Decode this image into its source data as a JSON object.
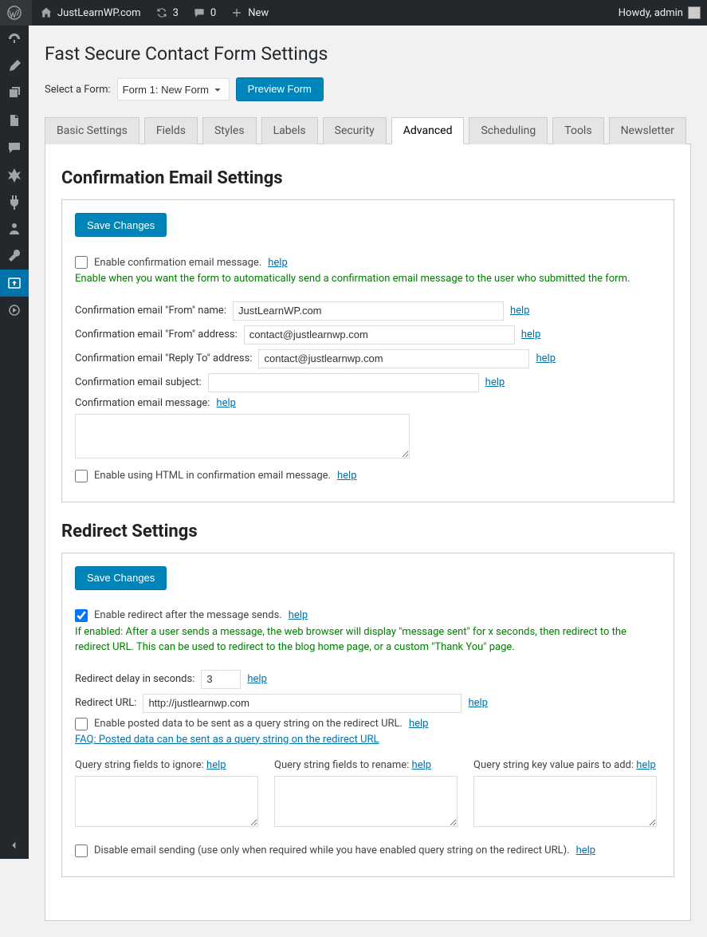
{
  "adminbar": {
    "site_name": "JustLearnWP.com",
    "updates_count": "3",
    "comments_count": "0",
    "new_label": "New",
    "howdy_prefix": "Howdy,",
    "username": "admin"
  },
  "page_title": "Fast Secure Contact Form Settings",
  "form_select": {
    "label": "Select a Form:",
    "selected": "Form 1: New Form"
  },
  "preview_button": "Preview Form",
  "tabs": [
    "Basic Settings",
    "Fields",
    "Styles",
    "Labels",
    "Security",
    "Advanced",
    "Scheduling",
    "Tools",
    "Newsletter"
  ],
  "active_tab_index": 5,
  "help_label": "help",
  "save_changes_label": "Save Changes",
  "confirmation": {
    "heading": "Confirmation Email Settings",
    "enable_label": "Enable confirmation email message.",
    "enable_desc": "Enable when you want the form to automatically send a confirmation email message to the user who submitted the form.",
    "from_name_label": "Confirmation email \"From\" name:",
    "from_name_value": "JustLearnWP.com",
    "from_addr_label": "Confirmation email \"From\" address:",
    "from_addr_value": "contact@justlearnwp.com",
    "reply_to_label": "Confirmation email \"Reply To\" address:",
    "reply_to_value": "contact@justlearnwp.com",
    "subject_label": "Confirmation email subject:",
    "subject_value": "",
    "message_label": "Confirmation email message:",
    "message_value": "",
    "enable_html_label": "Enable using HTML in confirmation email message."
  },
  "redirect": {
    "heading": "Redirect Settings",
    "enable_label": "Enable redirect after the message sends.",
    "enable_checked": true,
    "enable_desc": "If enabled: After a user sends a message, the web browser will display \"message sent\" for x seconds, then redirect to the redirect URL. This can be used to redirect to the blog home page, or a custom \"Thank You\" page.",
    "delay_label": "Redirect delay in seconds:",
    "delay_value": "3",
    "url_label": "Redirect URL:",
    "url_value": "http://justlearnwp.com",
    "enable_query_label": "Enable posted data to be sent as a query string on the redirect URL.",
    "faq_link": "FAQ: Posted data can be sent as a query string on the redirect URL",
    "qs_ignore_label": "Query string fields to ignore:",
    "qs_rename_label": "Query string fields to rename:",
    "qs_kv_label": "Query string key value pairs to add:",
    "disable_email_label": "Disable email sending (use only when required while you have enabled query string on the redirect URL)."
  }
}
